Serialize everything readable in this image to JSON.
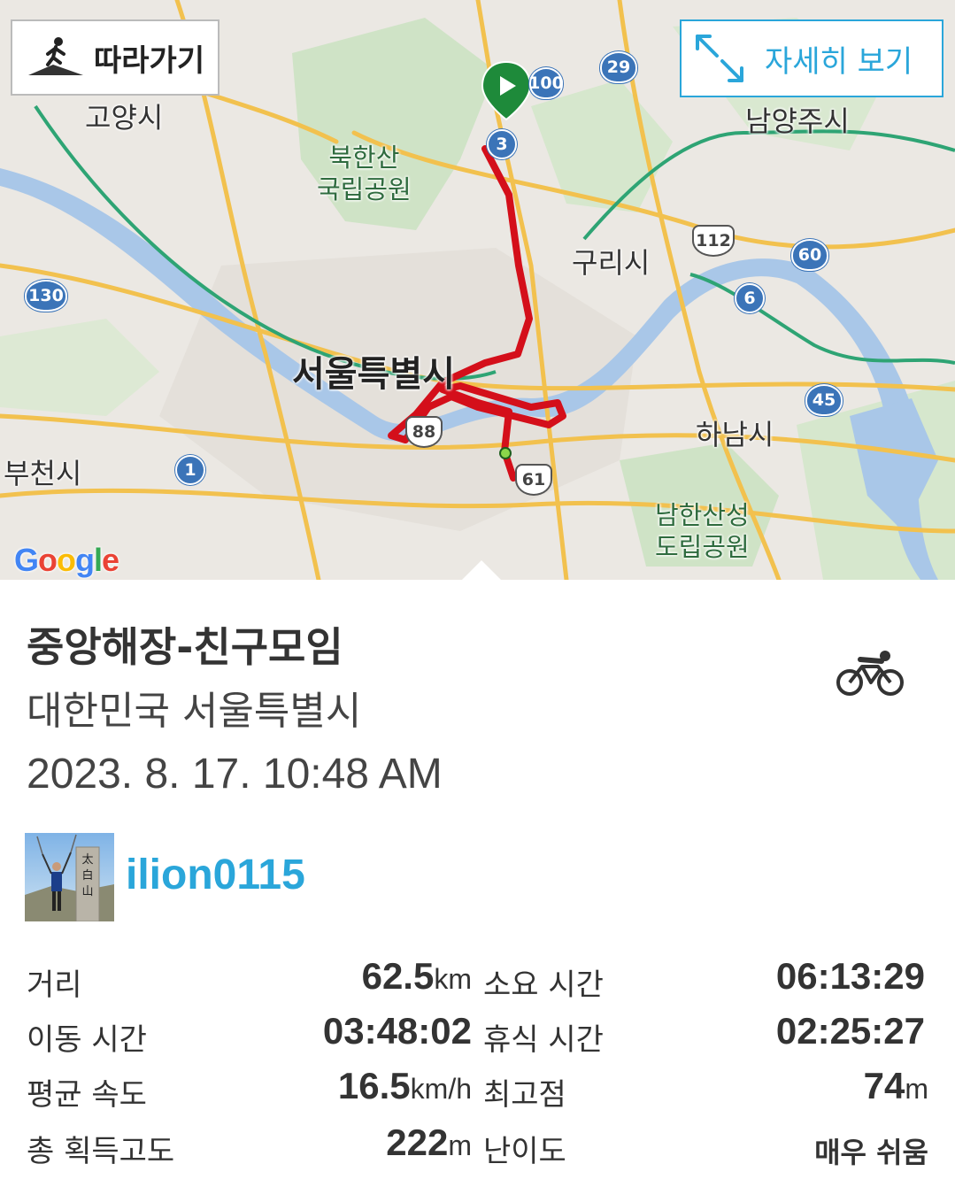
{
  "map": {
    "follow_label": "따라가기",
    "detail_label": "자세히 보기",
    "labels": {
      "goyang": "고양시",
      "bukhansan": "북한산\n국립공원",
      "namyangju": "남양주시",
      "guri": "구리시",
      "seoul": "서울특별시",
      "hanam": "하남시",
      "bucheon": "부천시",
      "namhansanseong": "남한산성\n도립공원"
    },
    "shields": {
      "r29": "29",
      "r100": "100",
      "r3": "3",
      "r112": "112",
      "r60": "60",
      "r130": "130",
      "r6": "6",
      "r45": "45",
      "r88": "88",
      "r1": "1",
      "r61": "61"
    },
    "google_logo": "Google"
  },
  "activity": {
    "title": "중앙해장-친구모임",
    "location": "대한민국 서울특별시",
    "datetime": "2023. 8. 17. 10:48 AM",
    "sport_icon": "cycling-icon",
    "user": {
      "name": "ilion0115",
      "avatar_caption": "太白山"
    }
  },
  "stats": {
    "distance_label": "거리",
    "distance_value": "62.5",
    "distance_unit": "km",
    "duration_label": "소요 시간",
    "duration_value": "06:13:29",
    "moving_label": "이동 시간",
    "moving_value": "03:48:02",
    "rest_label": "휴식 시간",
    "rest_value": "02:25:27",
    "avg_speed_label": "평균 속도",
    "avg_speed_value": "16.5",
    "avg_speed_unit": "km/h",
    "max_elev_label": "최고점",
    "max_elev_value": "74",
    "max_elev_unit": "m",
    "gain_label": "총 획득고도",
    "gain_value": "222",
    "gain_unit": "m",
    "difficulty_label": "난이도",
    "difficulty_value": "매우 쉬움"
  },
  "colors": {
    "accent": "#2aa6da",
    "route": "#d40f1a",
    "river": "#a9c7e8",
    "park": "#c9dfc3",
    "road": "#f2c14e"
  }
}
